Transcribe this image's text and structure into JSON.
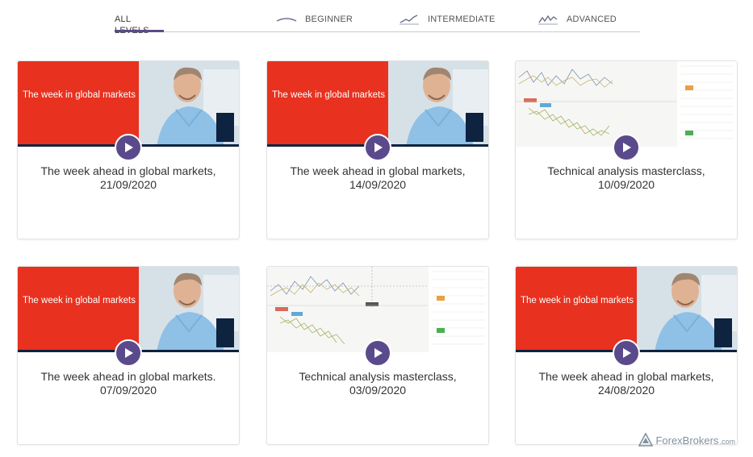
{
  "filters": {
    "tabs": [
      {
        "label": "ALL LEVELS",
        "active": true
      },
      {
        "label": "BEGINNER",
        "icon": "beginner-curve-icon"
      },
      {
        "label": "INTERMEDIATE",
        "icon": "intermediate-chart-icon"
      },
      {
        "label": "ADVANCED",
        "icon": "advanced-chart-icon"
      }
    ]
  },
  "videos": [
    {
      "thumbnail_text": "The week in global markets",
      "title": "The week ahead in global markets, 21/09/2020",
      "thumb": "presenter"
    },
    {
      "thumbnail_text": "The week in global markets",
      "title": "The week ahead in global markets, 14/09/2020",
      "thumb": "presenter"
    },
    {
      "thumbnail_text": "",
      "title": "Technical analysis masterclass, 10/09/2020",
      "thumb": "chart"
    },
    {
      "thumbnail_text": "The week in global markets",
      "title": "The week ahead in global markets. 07/09/2020",
      "thumb": "presenter"
    },
    {
      "thumbnail_text": "",
      "title": "Technical analysis masterclass, 03/09/2020",
      "thumb": "chart"
    },
    {
      "thumbnail_text": "The week in global markets",
      "title": "The week ahead in global markets, 24/08/2020",
      "thumb": "presenter"
    }
  ],
  "watermark": {
    "brand": "ForexBrokers",
    "suffix": ".com"
  },
  "colors": {
    "accent": "#5b4a8b",
    "thumb_red": "#e8311f",
    "thumb_bar": "#0e2340"
  }
}
